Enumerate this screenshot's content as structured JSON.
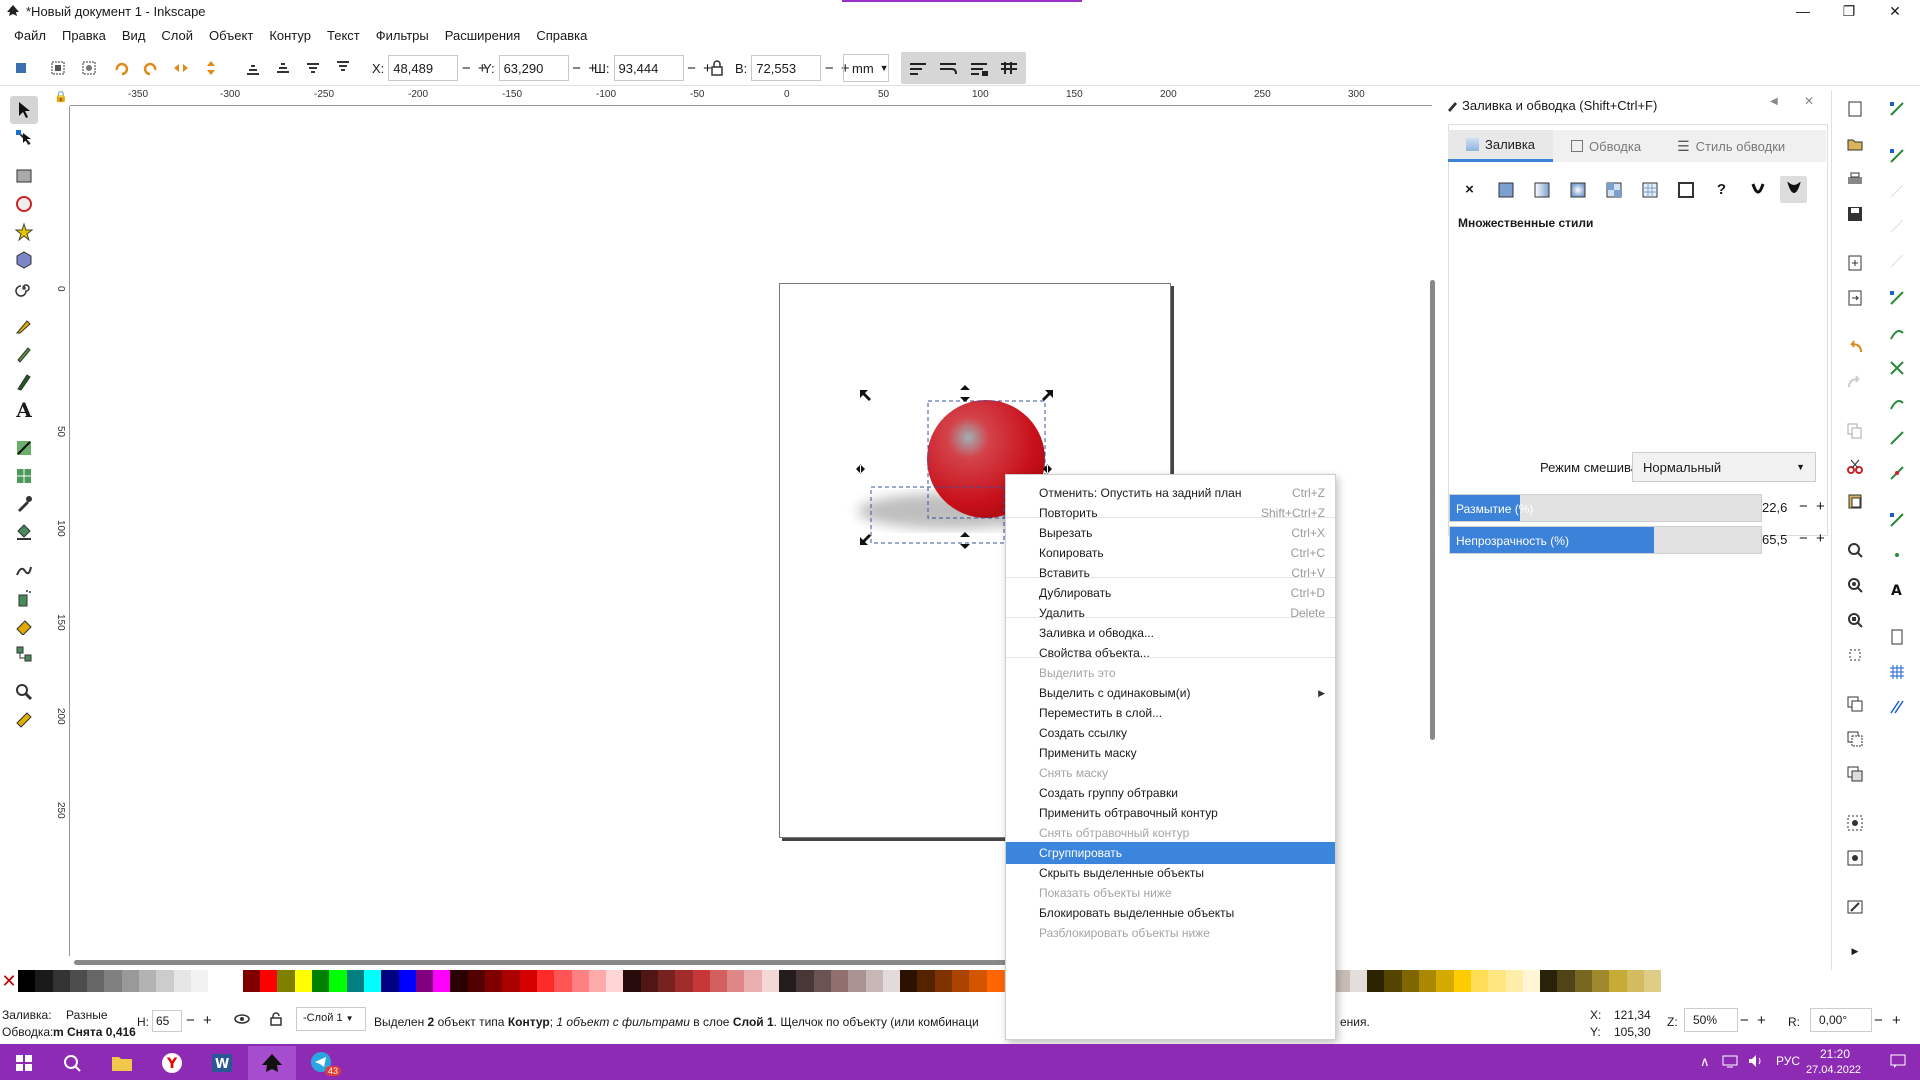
{
  "window": {
    "title": "*Новый документ 1 - Inkscape",
    "controls": [
      "—",
      "❐",
      "✕"
    ]
  },
  "menu": [
    "Файл",
    "Правка",
    "Вид",
    "Слой",
    "Объект",
    "Контур",
    "Текст",
    "Фильтры",
    "Расширения",
    "Справка"
  ],
  "toolbar": {
    "x_label": "X:",
    "x_value": "48,489",
    "y_label": "Y:",
    "y_value": "63,290",
    "w_label": "Ш:",
    "w_value": "93,444",
    "h_label": "В:",
    "h_value": "72,553",
    "unit": "mm"
  },
  "ruler_top": [
    "-350",
    "-300",
    "-250",
    "-200",
    "-150",
    "-100",
    "-50",
    "0",
    "50",
    "100",
    "150",
    "200",
    "250",
    "300"
  ],
  "ruler_left": [
    "0",
    "50",
    "100",
    "150",
    "200",
    "250"
  ],
  "dialog": {
    "title": "Заливка и обводка (Shift+Ctrl+F)",
    "tabs": [
      "Заливка",
      "Обводка",
      "Стиль обводки"
    ],
    "fill_icons": [
      "×",
      "?"
    ],
    "multi_styles": "Множественные стили",
    "blend_label": "Режим смешивания:",
    "blend_value": "Нормальный",
    "blur_label": "Размытие (%)",
    "blur_value": "22,6",
    "blur_fraction": 0.226,
    "opacity_label": "Непрозрачность (%)",
    "opacity_value": "65,5",
    "opacity_fraction": 0.655
  },
  "context_menu": [
    {
      "label": "Отменить: Опустить на задний план",
      "shortcut": "Ctrl+Z"
    },
    {
      "label": "Повторить",
      "shortcut": "Shift+Ctrl+Z"
    },
    {
      "label": "Вырезать",
      "shortcut": "Ctrl+X"
    },
    {
      "label": "Копировать",
      "shortcut": "Ctrl+C"
    },
    {
      "label": "Вставить",
      "shortcut": "Ctrl+V"
    },
    {
      "label": "Дублировать",
      "shortcut": "Ctrl+D"
    },
    {
      "label": "Удалить",
      "shortcut": "Delete"
    },
    {
      "label": "Заливка и обводка...",
      "shortcut": ""
    },
    {
      "label": "Свойства объекта...",
      "shortcut": ""
    },
    {
      "label": "Выделить это",
      "shortcut": ""
    },
    {
      "label": "Выделить с одинаковым(и)",
      "shortcut": ""
    },
    {
      "label": "Переместить в слой...",
      "shortcut": ""
    },
    {
      "label": "Создать ссылку",
      "shortcut": ""
    },
    {
      "label": "Применить маску",
      "shortcut": ""
    },
    {
      "label": "Снять маску",
      "shortcut": ""
    },
    {
      "label": "Создать группу обтравки",
      "shortcut": ""
    },
    {
      "label": "Применить обтравочный контур",
      "shortcut": ""
    },
    {
      "label": "Снять обтравочный контур",
      "shortcut": ""
    },
    {
      "label": "Сгруппировать",
      "shortcut": ""
    },
    {
      "label": "Скрыть выделенные объекты",
      "shortcut": ""
    },
    {
      "label": "Показать объекты ниже",
      "shortcut": ""
    },
    {
      "label": "Блокировать выделенные объекты",
      "shortcut": ""
    },
    {
      "label": "Разблокировать объекты ниже",
      "shortcut": ""
    }
  ],
  "status": {
    "fill_label": "Заливка:",
    "fill_value": "Разные",
    "stroke_label": "Обводка:",
    "stroke_value": "m Снята 0,416",
    "h_label": "Н:",
    "h_value": "65",
    "layer": "-Слой 1",
    "msg_a": "Выделен ",
    "msg_b": "2",
    "msg_c": " объект типа ",
    "msg_d": "Контур",
    "msg_e": "; ",
    "msg_f": "1 объект с фильтрами",
    "msg_g": "  в слое ",
    "msg_h": "Слой 1",
    "msg_i": ". Щелчок по объекту (или комбинаци",
    "msg_tail": "ения.",
    "x_label": "X:",
    "x_value": "121,34",
    "y_label": "Y:",
    "y_value": "105,30",
    "z_label": "Z:",
    "z_value": "50%",
    "r_label": "R:",
    "r_value": "0,00°"
  },
  "taskbar": {
    "lang": "РУС",
    "time": "21:20",
    "date": "27.04.2022",
    "telegram_badge": "43"
  },
  "colors": {
    "accent": "#3c85dc",
    "taskbar": "#8e2bb5",
    "sphere": "#c8101a"
  }
}
